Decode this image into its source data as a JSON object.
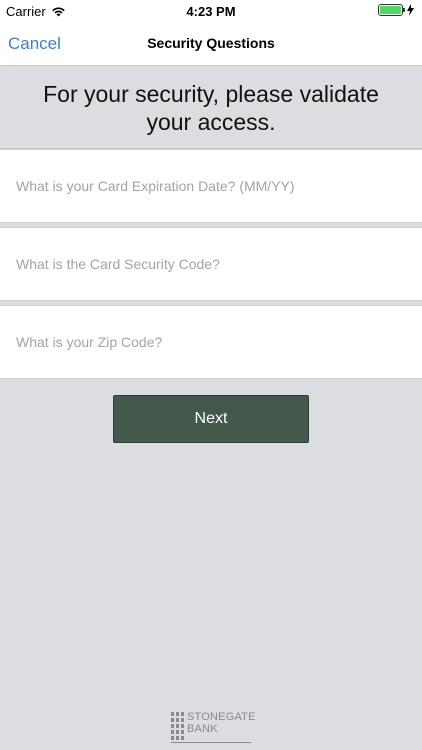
{
  "status_bar": {
    "carrier": "Carrier",
    "time": "4:23 PM",
    "battery_level": 1.0
  },
  "nav": {
    "cancel_label": "Cancel",
    "title": "Security Questions"
  },
  "prompt": {
    "text": "For your security, please validate your access."
  },
  "fields": {
    "expiration": {
      "placeholder": "What is your Card Expiration Date? (MM/YY)",
      "value": ""
    },
    "security_code": {
      "placeholder": "What is the Card Security Code?",
      "value": ""
    },
    "zip_code": {
      "placeholder": "What is your Zip Code?",
      "value": ""
    }
  },
  "next_button": {
    "label": "Next"
  },
  "logo": {
    "line1": "STONEGATE",
    "line2": "BANK"
  },
  "colors": {
    "accent": "#3b7fd6",
    "button": "#43594c",
    "background": "#dcdde0",
    "battery": "#4cd964"
  },
  "icons": [
    "wifi-icon",
    "battery-icon",
    "charging-bolt-icon",
    "bank-logo-mark"
  ]
}
